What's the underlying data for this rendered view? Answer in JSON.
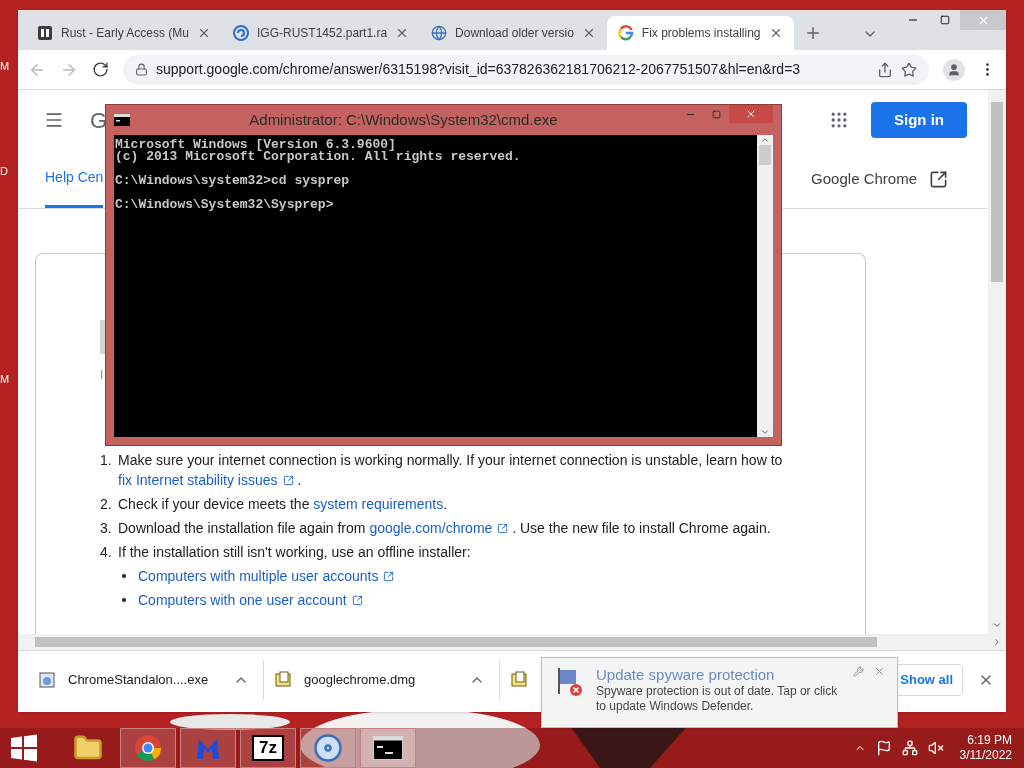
{
  "desktop_labels": [
    "M",
    "D",
    "M"
  ],
  "browser": {
    "tabs": [
      {
        "title": "Rust - Early Access (Mu",
        "selected": false
      },
      {
        "title": "IGG-RUST1452.part1.ra",
        "selected": false
      },
      {
        "title": "Download older versio",
        "selected": false
      },
      {
        "title": "Fix problems installing",
        "selected": true
      }
    ],
    "back": {
      "disabled": true
    },
    "forward": {
      "disabled": true
    },
    "url": "support.google.com/chrome/answer/6315198?visit_id=637826362181706212-2067751507&hl=en&rd=3",
    "page": {
      "logo_fragment": "G",
      "sign_in": "Sign in",
      "nav_tabs": [
        {
          "label": "Help Cen",
          "selected": true
        }
      ],
      "product_link": "Google Chrome",
      "subtitle_fragment": "I",
      "steps": [
        {
          "number": "1.",
          "parts": [
            {
              "text": "Make sure your internet connection is working normally. If your internet connection is unstable, learn how to "
            },
            {
              "link": "fix Internet stability issues",
              "external": true
            },
            {
              "text": " ."
            }
          ]
        },
        {
          "number": "2.",
          "parts": [
            {
              "text": "Check if your device meets the "
            },
            {
              "link": "system requirements",
              "external": false
            },
            {
              "text": "."
            }
          ]
        },
        {
          "number": "3.",
          "parts": [
            {
              "text": "Download the installation file again from "
            },
            {
              "link": "google.com/chrome",
              "external": true
            },
            {
              "text": " . Use the new file to install Chrome again."
            }
          ]
        },
        {
          "number": "4.",
          "parts": [
            {
              "text": "If the installation still isn't working, use an offline installer:"
            }
          ],
          "children": [
            {
              "link": "Computers with multiple user accounts",
              "external": true
            },
            {
              "link": "Computers with one user account",
              "external": true
            }
          ]
        }
      ]
    },
    "downloads": [
      {
        "name": "ChromeStandalon....exe",
        "kind": "installer"
      },
      {
        "name": "googlechrome.dmg",
        "kind": "document"
      },
      {
        "kind": "document"
      }
    ],
    "show_all": "Show all"
  },
  "cmd": {
    "title": "Administrator: C:\\Windows\\System32\\cmd.exe",
    "blocks": [
      [
        "Microsoft Windows [Version 6.3.9600]",
        "(c) 2013 Microsoft Corporation. All rights reserved."
      ],
      [
        "C:\\Windows\\system32>cd sysprep"
      ],
      [
        "C:\\Windows\\System32\\Sysprep>"
      ]
    ]
  },
  "notification": {
    "title": "Update spyware protection",
    "message": "Spyware protection is out of date. Tap or click to update Windows Defender."
  },
  "taskbar": {
    "apps": [
      {
        "kind": "explorer",
        "running": false,
        "selected": false
      },
      {
        "kind": "chrome",
        "running": true,
        "selected": false
      },
      {
        "kind": "malware",
        "running": true,
        "selected": false
      },
      {
        "kind": "sevenzip",
        "label": "7z",
        "running": true,
        "selected": false
      },
      {
        "kind": "setup",
        "running": true,
        "selected": false
      },
      {
        "kind": "cmd",
        "running": true,
        "selected": true
      }
    ],
    "time": "6:19 PM",
    "date": "3/11/2022"
  }
}
